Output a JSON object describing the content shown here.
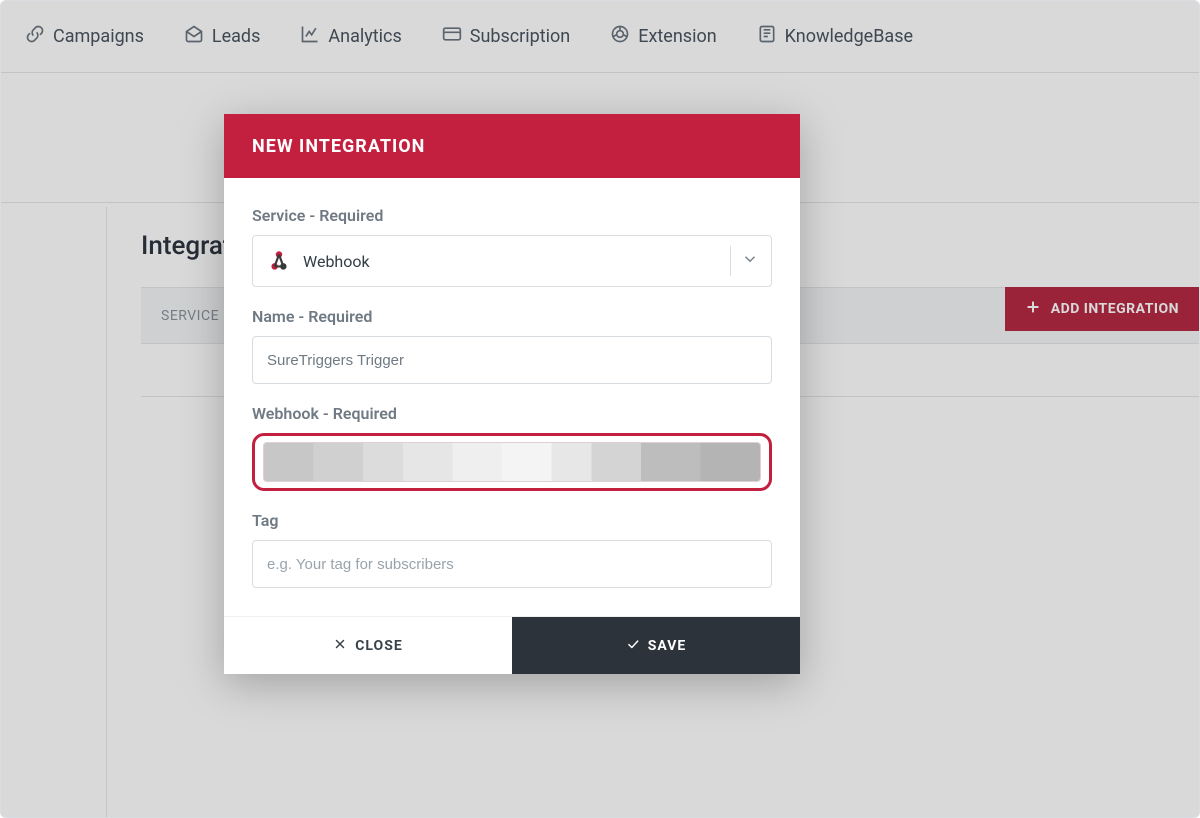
{
  "nav": {
    "campaigns": "Campaigns",
    "leads": "Leads",
    "analytics": "Analytics",
    "subscription": "Subscription",
    "extension": "Extension",
    "knowledgebase": "KnowledgeBase"
  },
  "page": {
    "title": "Integrations",
    "title_visible_fragment": "Integrat",
    "table_col_service": "SERVICE",
    "add_integration_label": "ADD INTEGRATION"
  },
  "modal": {
    "title": "NEW INTEGRATION",
    "labels": {
      "service": "Service - Required",
      "name": "Name - Required",
      "webhook": "Webhook - Required",
      "tag": "Tag"
    },
    "service_value": "Webhook",
    "name_value": "SureTriggers Trigger",
    "webhook_value_redacted": true,
    "tag_placeholder": "e.g. Your tag for subscribers",
    "buttons": {
      "close": "CLOSE",
      "save": "SAVE"
    }
  },
  "colors": {
    "brand_red": "#c3203f",
    "brand_red_dark": "#b62a45",
    "dark": "#2c333b"
  }
}
